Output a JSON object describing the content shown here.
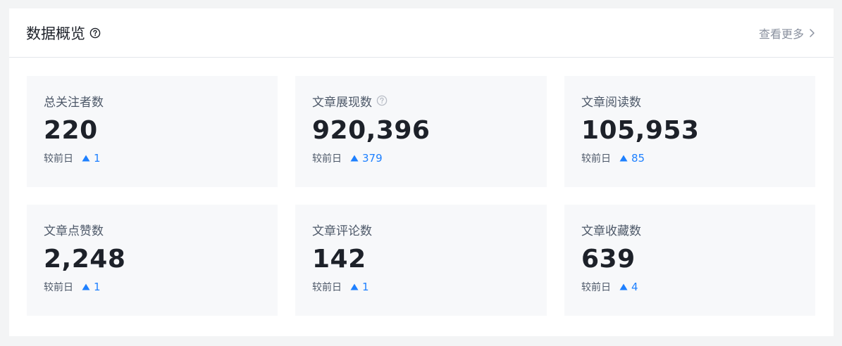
{
  "header": {
    "title": "数据概览",
    "more_label": "查看更多"
  },
  "colors": {
    "accent": "#1e80ff",
    "text_primary": "#1d2129",
    "text_secondary": "#4e5969",
    "card_bg": "#f7f8fa"
  },
  "cards": [
    {
      "label": "总关注者数",
      "value": "220",
      "delta_label": "较前日",
      "delta_value": "1",
      "has_help": false
    },
    {
      "label": "文章展现数",
      "value": "920,396",
      "delta_label": "较前日",
      "delta_value": "379",
      "has_help": true
    },
    {
      "label": "文章阅读数",
      "value": "105,953",
      "delta_label": "较前日",
      "delta_value": "85",
      "has_help": false
    },
    {
      "label": "文章点赞数",
      "value": "2,248",
      "delta_label": "较前日",
      "delta_value": "1",
      "has_help": false
    },
    {
      "label": "文章评论数",
      "value": "142",
      "delta_label": "较前日",
      "delta_value": "1",
      "has_help": false
    },
    {
      "label": "文章收藏数",
      "value": "639",
      "delta_label": "较前日",
      "delta_value": "4",
      "has_help": false
    }
  ]
}
